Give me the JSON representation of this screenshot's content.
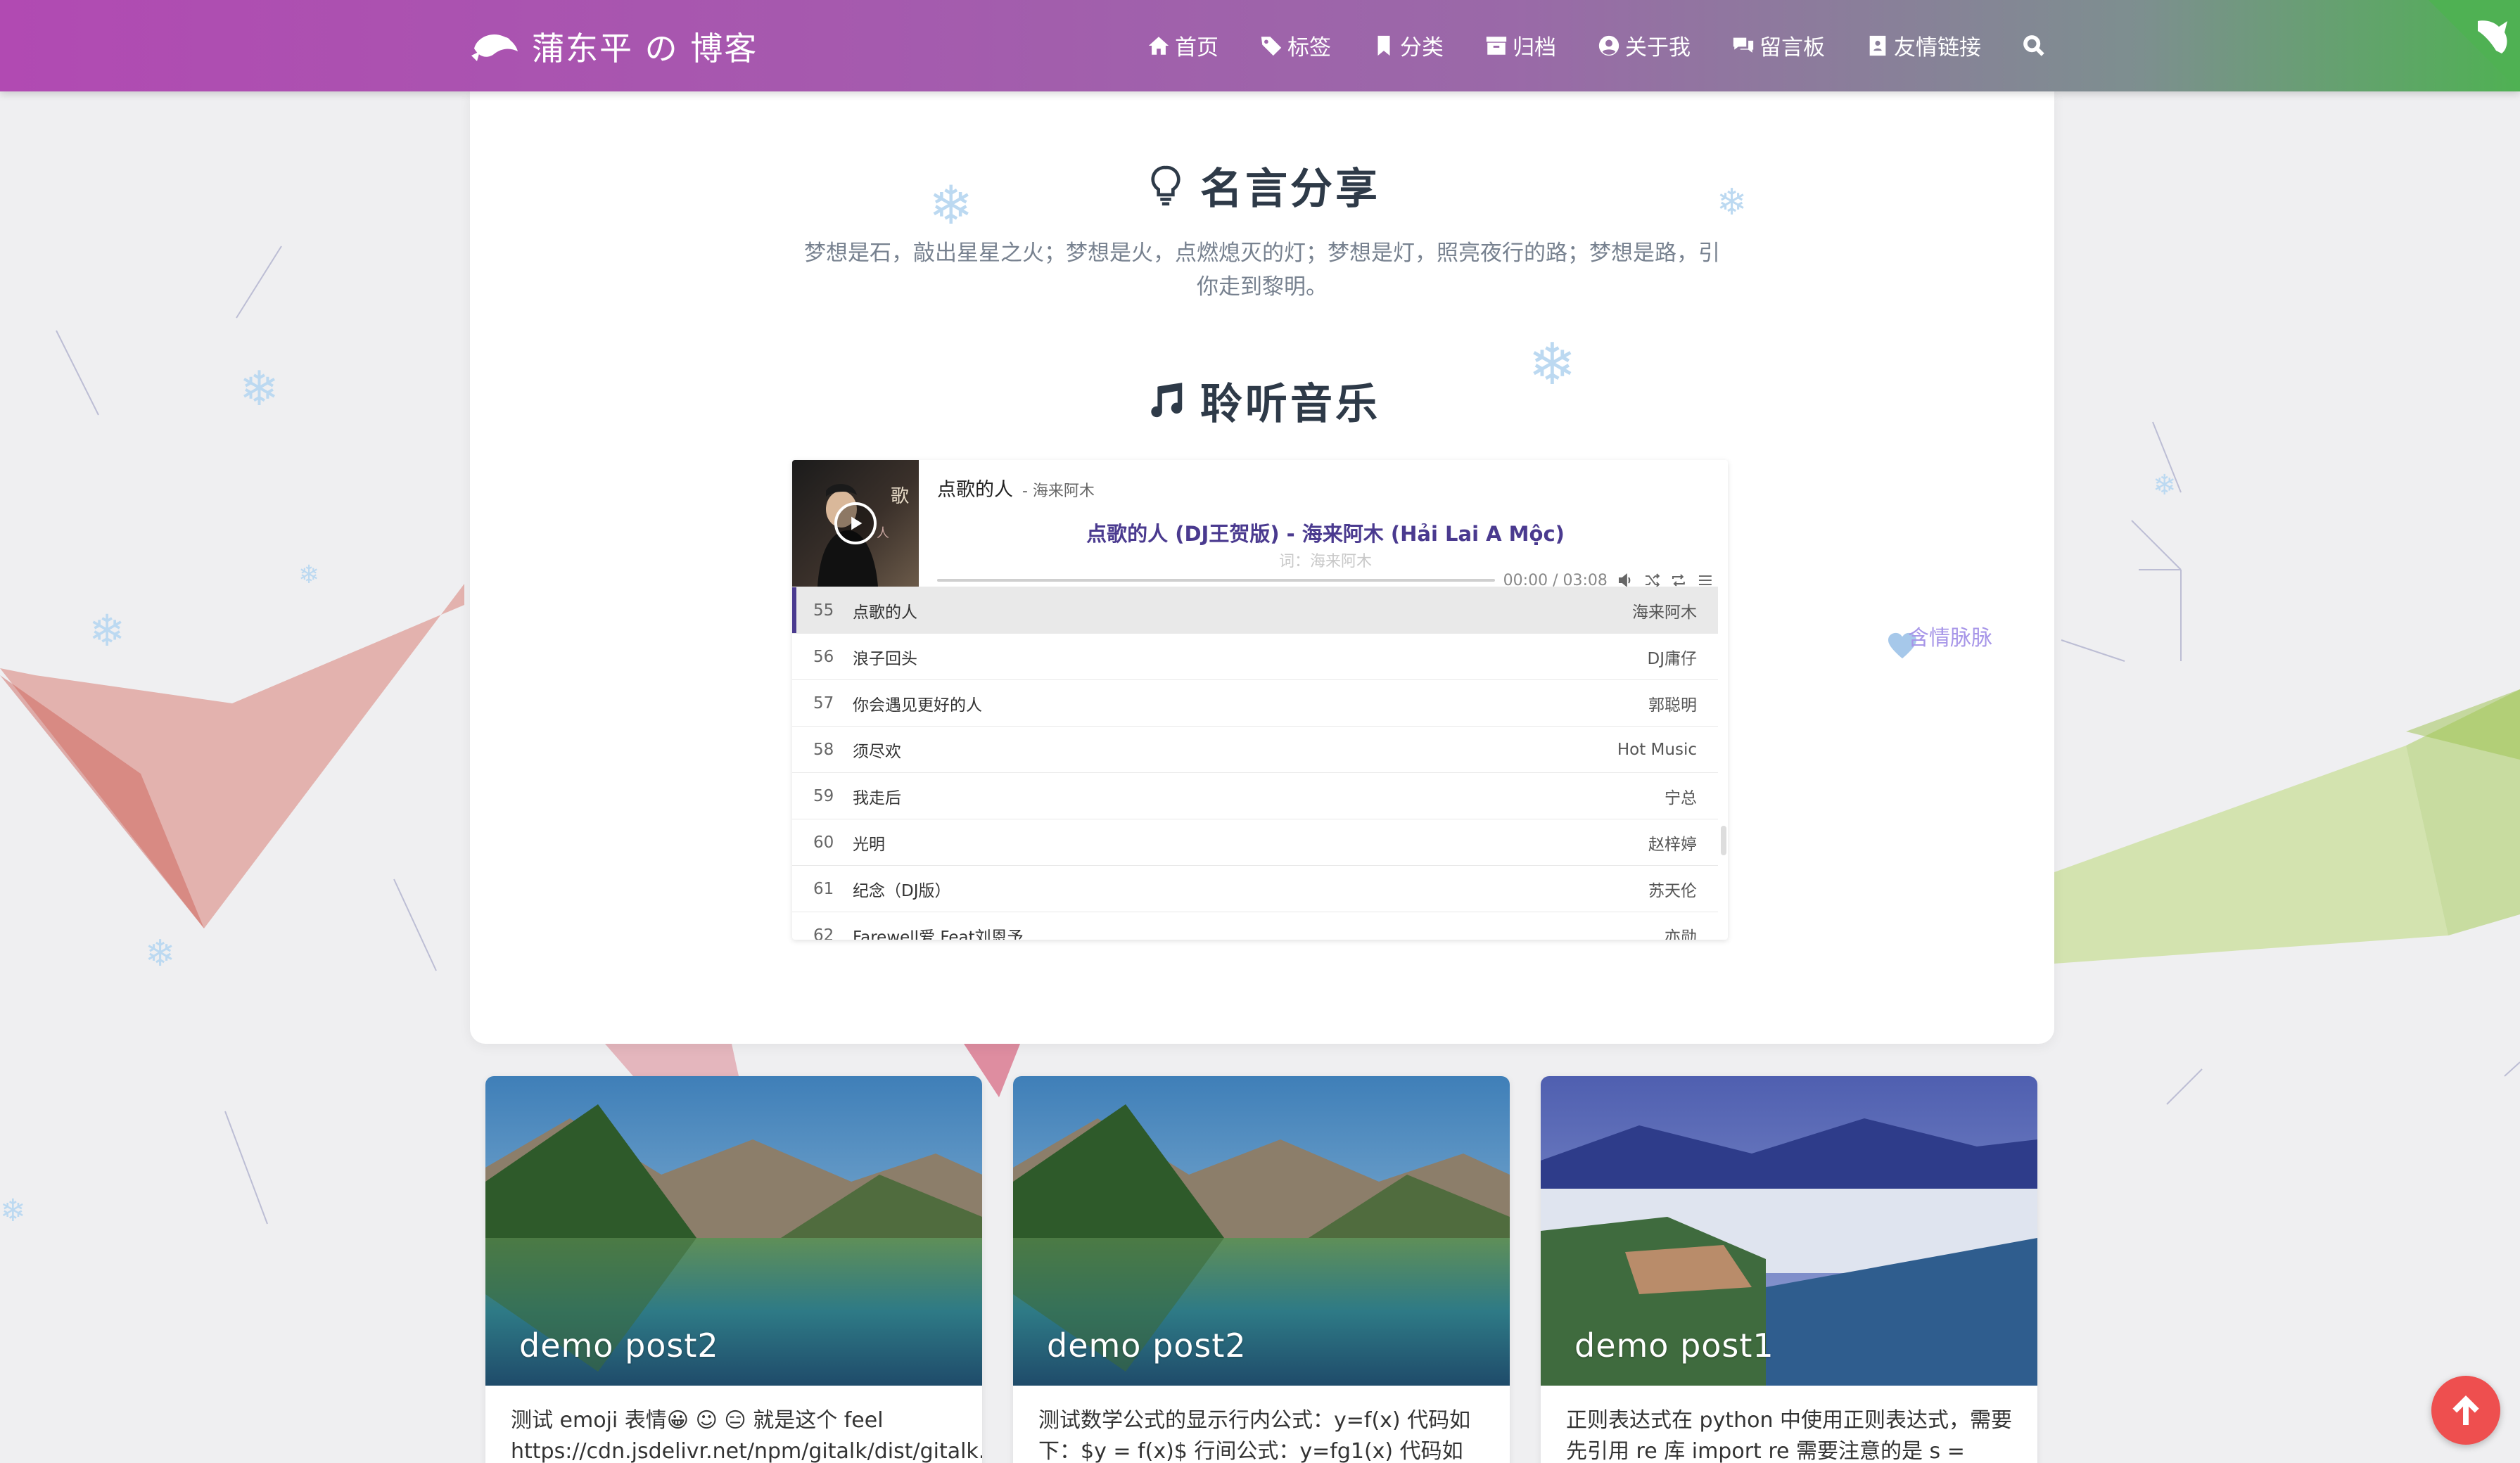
{
  "brand": {
    "title": "蒲东平 の 博客",
    "logo_icon": "fish-logo-icon"
  },
  "nav": {
    "items": [
      {
        "label": "首页",
        "icon": "home-icon"
      },
      {
        "label": "标签",
        "icon": "tag-icon"
      },
      {
        "label": "分类",
        "icon": "bookmark-icon"
      },
      {
        "label": "归档",
        "icon": "archive-icon"
      },
      {
        "label": "关于我",
        "icon": "user-circle-icon"
      },
      {
        "label": "留言板",
        "icon": "comments-icon"
      },
      {
        "label": "友情链接",
        "icon": "address-book-icon"
      }
    ],
    "search_icon": "search-icon"
  },
  "quote_section": {
    "title": "名言分享",
    "icon": "lightbulb-icon",
    "text": "梦想是石，敲出星星之火；梦想是火，点燃熄灭的灯；梦想是灯，照亮夜行的路；梦想是路，引你走到黎明。"
  },
  "music_section": {
    "title": "聆听音乐",
    "icon": "music-note-icon"
  },
  "player": {
    "song_title": "点歌的人",
    "song_artist": " - 海来阿木",
    "lyric": "点歌的人 (DJ王贺版) - 海来阿木 (Hải Lai A Mộc)",
    "lyric_sub": "词：海来阿木",
    "time": "00:00 / 03:08",
    "progress": 0,
    "playlist": [
      {
        "index": "55",
        "name": "点歌的人",
        "artist": "海来阿木",
        "active": true
      },
      {
        "index": "56",
        "name": "浪子回头",
        "artist": "DJ庸仔"
      },
      {
        "index": "57",
        "name": "你会遇见更好的人",
        "artist": "郭聪明"
      },
      {
        "index": "58",
        "name": "须尽欢",
        "artist": "Hot Music"
      },
      {
        "index": "59",
        "name": "我走后",
        "artist": "宁总"
      },
      {
        "index": "60",
        "name": "光明",
        "artist": "赵梓婷"
      },
      {
        "index": "61",
        "name": "纪念（DJ版）",
        "artist": "苏天伦"
      },
      {
        "index": "62",
        "name": "Farewell爱 Feat刘恩予",
        "artist": "亦勋"
      }
    ]
  },
  "side_widget": {
    "text": "含情脉脉",
    "icon": "heart-icon"
  },
  "posts": [
    {
      "title": "demo post2",
      "excerpt": "测试 emoji 表情😀 ☺ 😑 就是这个 feel https://cdn.jsdelivr.net/npm/gitalk/dist/gitalk.csshttps://c"
    },
    {
      "title": "demo post2",
      "excerpt": "测试数学公式的显示行内公式：y=f(x) 代码如下：$y = f(x)$ 行间公式：y=fg1(x) 代码如"
    },
    {
      "title": "demo post1",
      "excerpt": "正则表达式在 python 中使用正则表达式，需要先引用 re 库 import re 需要注意的是 s = 'ABC"
    }
  ],
  "back_to_top_icon": "arrow-up-icon",
  "colors": {
    "nav_start": "#b14ab2",
    "nav_end": "#4fb153",
    "accent": "#4a3a8f",
    "back_top": "#ee4f4f"
  }
}
